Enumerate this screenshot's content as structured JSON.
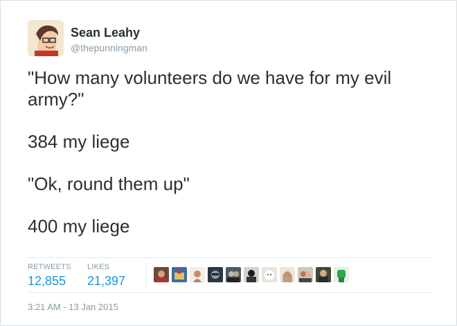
{
  "user": {
    "name": "Sean Leahy",
    "handle": "@thepunningman"
  },
  "tweet": {
    "paragraphs": [
      "\"How many volunteers do we have for my evil army?\"",
      "384 my liege",
      "\"Ok, round them up\"",
      "400 my liege"
    ]
  },
  "stats": {
    "retweets_label": "RETWEETS",
    "retweets_value": "12,855",
    "likes_label": "LIKES",
    "likes_value": "21,397"
  },
  "timestamp": "3:21 AM - 13 Jan 2015",
  "colors": {
    "stat_value": "#1b95e0",
    "text": "#292f33",
    "muted": "#8899a6"
  }
}
